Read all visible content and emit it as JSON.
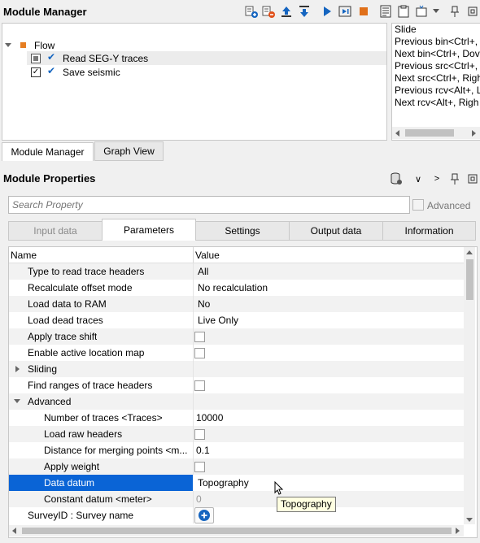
{
  "module_manager": {
    "title": "Module Manager",
    "tree": {
      "root": "Flow",
      "items": [
        {
          "label": "Read SEG-Y traces",
          "checked": false
        },
        {
          "label": "Save seismic",
          "checked": true
        }
      ]
    },
    "shortcuts": [
      "Slide",
      "Previous bin<Ctrl+,",
      "Next bin<Ctrl+, Dov",
      "Previous src<Ctrl+,",
      "Next src<Ctrl+, Righ",
      "Previous rcv<Alt+, L",
      "Next rcv<Alt+, Righ"
    ],
    "bottom_tabs": [
      "Module Manager",
      "Graph View"
    ]
  },
  "module_properties": {
    "title": "Module Properties",
    "search_placeholder": "Search Property",
    "advanced_label": "Advanced",
    "tabs": [
      "Input data",
      "Parameters",
      "Settings",
      "Output data",
      "Information"
    ],
    "active_tab": "Parameters",
    "columns": {
      "name": "Name",
      "value": "Value"
    },
    "rows": [
      {
        "name": "Type to read trace headers",
        "value": "All"
      },
      {
        "name": "Recalculate offset mode",
        "value": "No recalculation"
      },
      {
        "name": "Load data to RAM",
        "value": "No"
      },
      {
        "name": "Load dead traces",
        "value": "Live Only"
      },
      {
        "name": "Apply trace shift",
        "value": ""
      },
      {
        "name": "Enable active location map",
        "value": ""
      },
      {
        "name": "Sliding",
        "value": ""
      },
      {
        "name": "Find ranges of trace headers",
        "value": ""
      },
      {
        "name": "Advanced",
        "value": ""
      },
      {
        "name": "Number of traces <Traces>",
        "value": "10000"
      },
      {
        "name": "Load raw headers",
        "value": ""
      },
      {
        "name": "Distance for merging points <m...",
        "value": "0.1"
      },
      {
        "name": "Apply weight",
        "value": ""
      },
      {
        "name": "Data datum",
        "value": "Topography"
      },
      {
        "name": "Constant datum <meter>",
        "value": "0"
      },
      {
        "name": "SurveyID : Survey name",
        "value": ""
      }
    ],
    "tooltip": "Topography"
  }
}
